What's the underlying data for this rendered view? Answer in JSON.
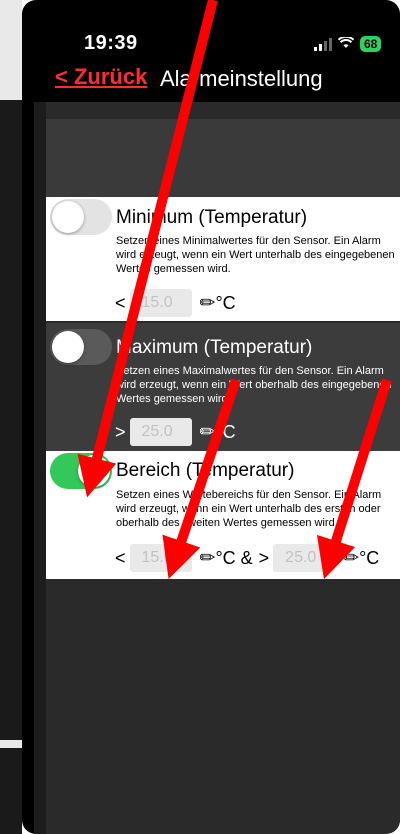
{
  "status_bar": {
    "time": "19:39",
    "battery": "68"
  },
  "nav": {
    "back_label": "< Zurück",
    "title": "Alarmeinstellung"
  },
  "alarms": [
    {
      "title": "Minimum (Temperatur)",
      "description": "Setzen eines Minimalwertes für den Sensor. Ein Alarm wird erzeugt, wenn ein Wert unterhalb des eingegebenen Wertes gemessen wird.",
      "enabled": false,
      "operator": "<",
      "value": "15.0",
      "unit": "°C"
    },
    {
      "title": "Maximum (Temperatur)",
      "description": "Setzen eines Maximalwertes für den Sensor. Ein Alarm wird erzeugt, wenn ein Wert oberhalb des eingegebenen Wertes gemessen wird.",
      "enabled": false,
      "operator": ">",
      "value": "25.0",
      "unit": "°C"
    },
    {
      "title": "Bereich (Temperatur)",
      "description": "Setzen eines Wertebereichs für den Sensor. Ein Alarm wird erzeugt, wenn ein Wert unterhalb des ersten oder oberhalb des zweiten Wertes gemessen wird.",
      "enabled": true,
      "operator_low": "<",
      "value_low": "15.0",
      "unit_low": "°C &",
      "operator_high": ">",
      "value_high": "25.0",
      "unit_high": "°C"
    }
  ],
  "annotation_color": "#ff0000",
  "toggle_on_color": "#34c759"
}
